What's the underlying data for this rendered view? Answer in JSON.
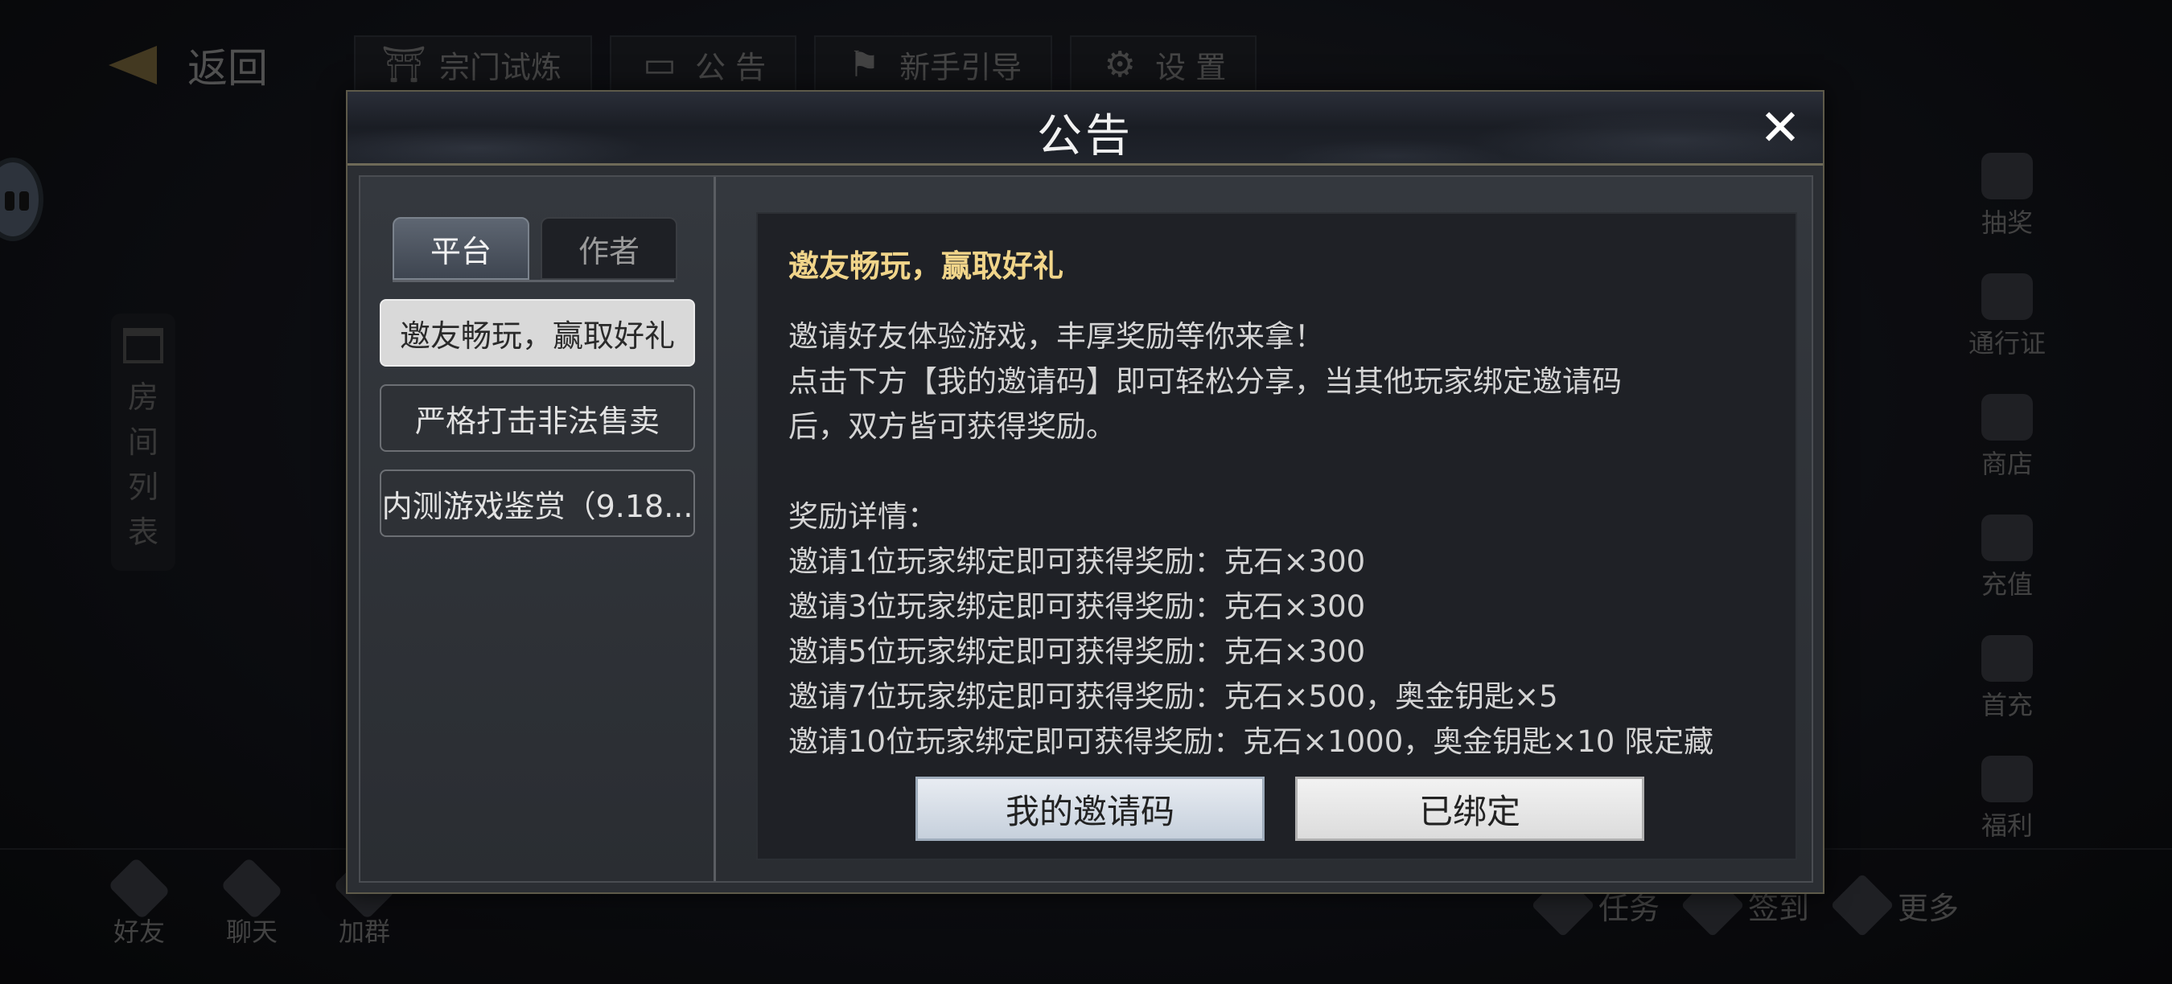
{
  "background": {
    "back_label": "返回",
    "top_tabs": [
      {
        "label": "宗门试炼",
        "icon": "temple-icon"
      },
      {
        "label": "公 告",
        "icon": "scroll-icon"
      },
      {
        "label": "新手引导",
        "icon": "signpost-icon"
      },
      {
        "label": "设 置",
        "icon": "gear-icon"
      }
    ],
    "room_list_label": [
      "房",
      "间",
      "列",
      "表"
    ],
    "right_menu": [
      "抽奖",
      "通行证",
      "商店",
      "充值",
      "首充",
      "福利"
    ],
    "bottom_left": [
      "好友",
      "聊天",
      "加群"
    ],
    "bottom_right": [
      "任务",
      "签到",
      "更多"
    ]
  },
  "dialog": {
    "title": "公告",
    "close_icon": "close-icon",
    "tabs": [
      {
        "label": "平台",
        "active": true
      },
      {
        "label": "作者",
        "active": false
      }
    ],
    "announcements": [
      {
        "label": "邀友畅玩，赢取好礼",
        "active": true
      },
      {
        "label": "严格打击非法售卖",
        "active": false
      },
      {
        "label": "内测游戏鉴赏（9.18...",
        "active": false
      }
    ],
    "content": {
      "title": "邀友畅玩，赢取好礼",
      "body": "邀请好友体验游戏，丰厚奖励等你来拿！\n点击下方【我的邀请码】即可轻松分享，当其他玩家绑定邀请码\n后，双方皆可获得奖励。\n\n奖励详情：\n邀请1位玩家绑定即可获得奖励：克石×300\n邀请3位玩家绑定即可获得奖励：克石×300\n邀请5位玩家绑定即可获得奖励：克石×300\n邀请7位玩家绑定即可获得奖励：克石×500，奥金钥匙×5\n邀请10位玩家绑定即可获得奖励：克石×1000，奥金钥匙×10 限定藏"
    },
    "buttons": {
      "invite_code": "我的邀请码",
      "bound": "已绑定"
    }
  },
  "colors": {
    "content_title": "#f1d58a",
    "active_tab": "#5e6672",
    "active_item": "#d9d9d9"
  }
}
